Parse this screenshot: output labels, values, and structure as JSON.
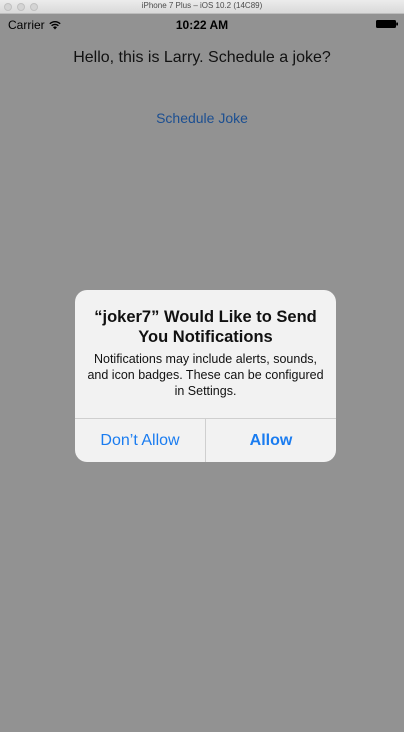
{
  "simulator": {
    "title": "iPhone 7 Plus – iOS 10.2 (14C89)"
  },
  "status_bar": {
    "carrier": "Carrier",
    "time": "10:22 AM",
    "icons": [
      "wifi-icon",
      "battery-icon"
    ]
  },
  "main": {
    "greeting": "Hello, this is Larry. Schedule a joke?",
    "schedule_button": "Schedule Joke"
  },
  "alert": {
    "title": "“joker7” Would Like to Send You Notifications",
    "message": "Notifications may include alerts, sounds, and icon badges. These can be configured in Settings.",
    "deny_label": "Don’t Allow",
    "allow_label": "Allow"
  },
  "colors": {
    "screen_dim": "#929292",
    "link_dim": "#1c4f91",
    "alert_bg": "#f2f2f2",
    "alert_button": "#1a7cf0"
  }
}
